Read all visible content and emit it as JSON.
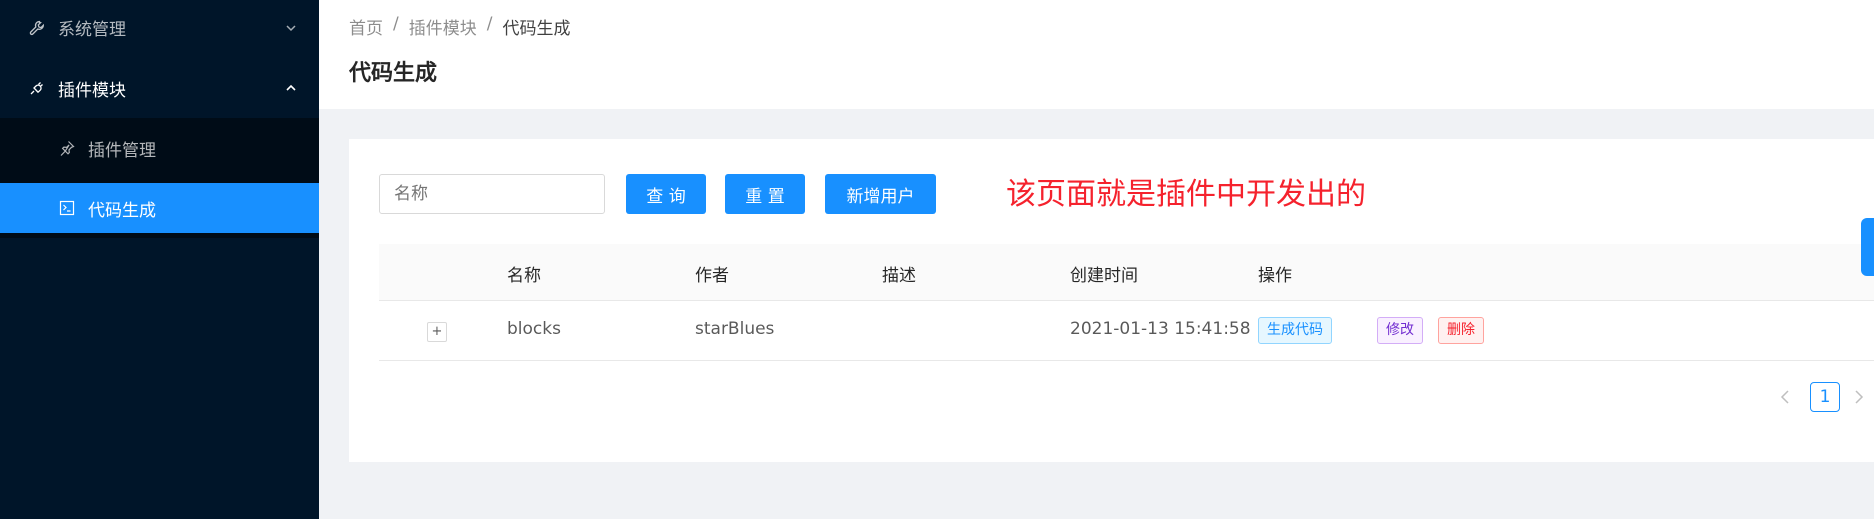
{
  "sidebar": {
    "items": [
      {
        "label": "系统管理",
        "icon": "wrench-icon"
      },
      {
        "label": "插件模块",
        "icon": "plug-icon"
      },
      {
        "label": "插件管理",
        "icon": "pushpin-icon"
      },
      {
        "label": "代码生成",
        "icon": "code-icon"
      }
    ]
  },
  "breadcrumb": {
    "home": "首页",
    "sep1": "/",
    "module": "插件模块",
    "sep2": "/",
    "current": "代码生成"
  },
  "page": {
    "title": "代码生成"
  },
  "search": {
    "placeholder": "名称"
  },
  "buttons": {
    "query": "查 询",
    "reset": "重 置",
    "add": "新增用户"
  },
  "annotation": "该页面就是插件中开发出的",
  "table": {
    "columns": [
      "名称",
      "作者",
      "描述",
      "创建时间",
      "操作"
    ],
    "rows": [
      {
        "expand": "+",
        "name": "blocks",
        "author": "starBlues",
        "desc": "",
        "time": "2021-01-13 15:41:58",
        "actions": {
          "generate": "生成代码",
          "edit": "修改",
          "delete": "删除"
        }
      }
    ]
  },
  "pagination": {
    "current": "1"
  },
  "colors": {
    "primary": "#1890ff",
    "sidebar": "#001529",
    "annotation": "#f5222d"
  }
}
